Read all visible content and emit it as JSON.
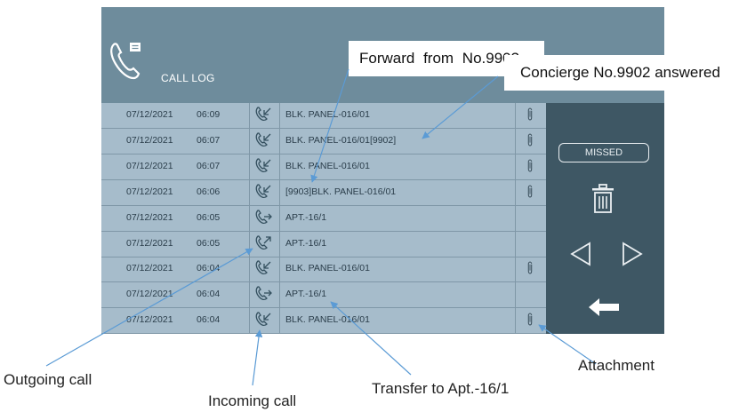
{
  "header": {
    "title": "CALL LOG"
  },
  "callouts": {
    "forward": "Forward  from  No.9903",
    "concierge": "Concierge No.9902 answered",
    "outgoing": "Outgoing call",
    "incoming": "Incoming call",
    "transfer": "Transfer to Apt.-16/1",
    "attachment": "Attachment"
  },
  "side": {
    "missed_label": "MISSED"
  },
  "rows": [
    {
      "date": "07/12/2021",
      "time": "06:09",
      "direction": "incoming",
      "name": "BLK. PANEL-016/01",
      "attachment": true
    },
    {
      "date": "07/12/2021",
      "time": "06:07",
      "direction": "incoming",
      "name": "BLK. PANEL-016/01[9902]",
      "attachment": true
    },
    {
      "date": "07/12/2021",
      "time": "06:07",
      "direction": "incoming",
      "name": "BLK. PANEL-016/01",
      "attachment": true
    },
    {
      "date": "07/12/2021",
      "time": "06:06",
      "direction": "incoming",
      "name": "[9903]BLK. PANEL-016/01",
      "attachment": true
    },
    {
      "date": "07/12/2021",
      "time": "06:05",
      "direction": "transfer",
      "name": "APT.-16/1",
      "attachment": false
    },
    {
      "date": "07/12/2021",
      "time": "06:05",
      "direction": "outgoing",
      "name": "APT.-16/1",
      "attachment": false
    },
    {
      "date": "07/12/2021",
      "time": "06:04",
      "direction": "incoming",
      "name": "BLK. PANEL-016/01",
      "attachment": true
    },
    {
      "date": "07/12/2021",
      "time": "06:04",
      "direction": "transfer",
      "name": "APT.-16/1",
      "attachment": false
    },
    {
      "date": "07/12/2021",
      "time": "06:04",
      "direction": "incoming",
      "name": "BLK. PANEL-016/01",
      "attachment": true
    }
  ],
  "colors": {
    "header": "#6e8c9c",
    "list": "#a6bccb",
    "sidebar": "#3e5764",
    "callout_arrow": "#5b9bd5"
  }
}
